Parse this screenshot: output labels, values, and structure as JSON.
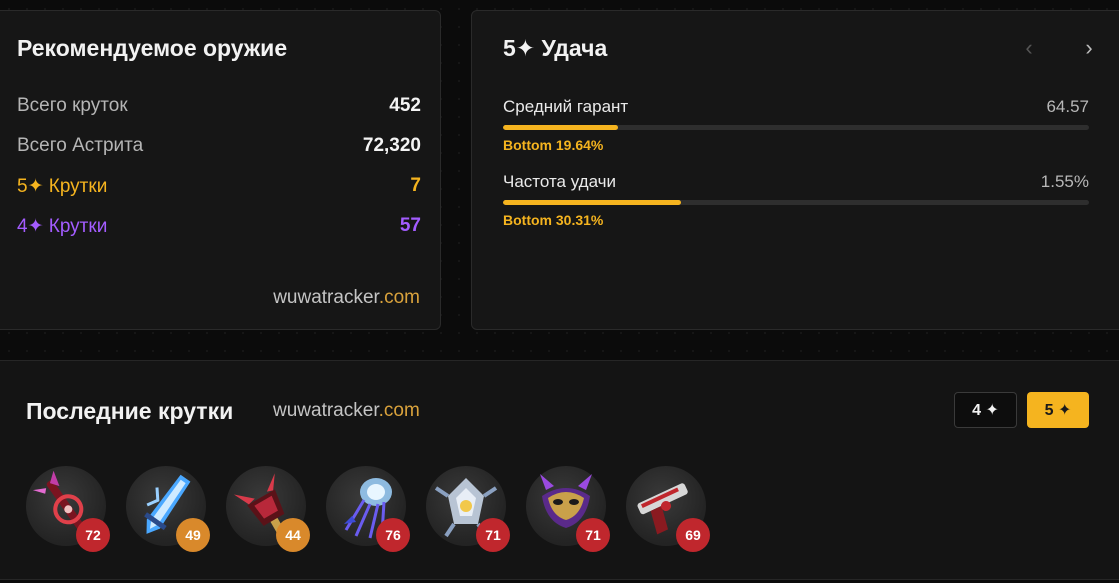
{
  "summary": {
    "title": "Рекомендуемое оружие",
    "stats": [
      {
        "label": "Всего круток",
        "value": "452"
      },
      {
        "label": "Всего Астрита",
        "value": "72,320"
      },
      {
        "label": "5✦ Крутки",
        "value": "7"
      },
      {
        "label": "4✦ Крутки",
        "value": "57"
      }
    ],
    "brand_main": "wuwatracker",
    "brand_tld": ".com"
  },
  "luck": {
    "title": "5✦ Удача",
    "prev_icon": "‹",
    "next_icon": "›",
    "metrics": [
      {
        "label": "Средний гарант",
        "value": "64.57",
        "rank": "Bottom 19.64%",
        "fill": 0.196
      },
      {
        "label": "Частота удачи",
        "value": "1.55%",
        "rank": "Bottom 30.31%",
        "fill": 0.303
      }
    ]
  },
  "recent": {
    "title": "Последние крутки",
    "brand_main": "wuwatracker",
    "brand_tld": ".com",
    "filters": [
      "4 ✦",
      "5 ✦"
    ],
    "pulls": [
      {
        "icon": "crimson-rectifier-weapon-icon",
        "pity": "72",
        "badge": "red"
      },
      {
        "icon": "ice-broadblade-weapon-icon",
        "pity": "49",
        "badge": "orange"
      },
      {
        "icon": "crimson-gauntlet-weapon-icon",
        "pity": "44",
        "badge": "orange"
      },
      {
        "icon": "jellyfish-rectifier-weapon-icon",
        "pity": "76",
        "badge": "red"
      },
      {
        "icon": "silver-gauntlet-weapon-icon",
        "pity": "71",
        "badge": "red"
      },
      {
        "icon": "violet-mask-rectifier-weapon-icon",
        "pity": "71",
        "badge": "red"
      },
      {
        "icon": "red-pistol-weapon-icon",
        "pity": "69",
        "badge": "red"
      }
    ]
  },
  "colors": {
    "gold": "#f5b41f",
    "purple": "#a35cff",
    "badge_red": "#c0272d",
    "badge_orange": "#d9892b"
  }
}
